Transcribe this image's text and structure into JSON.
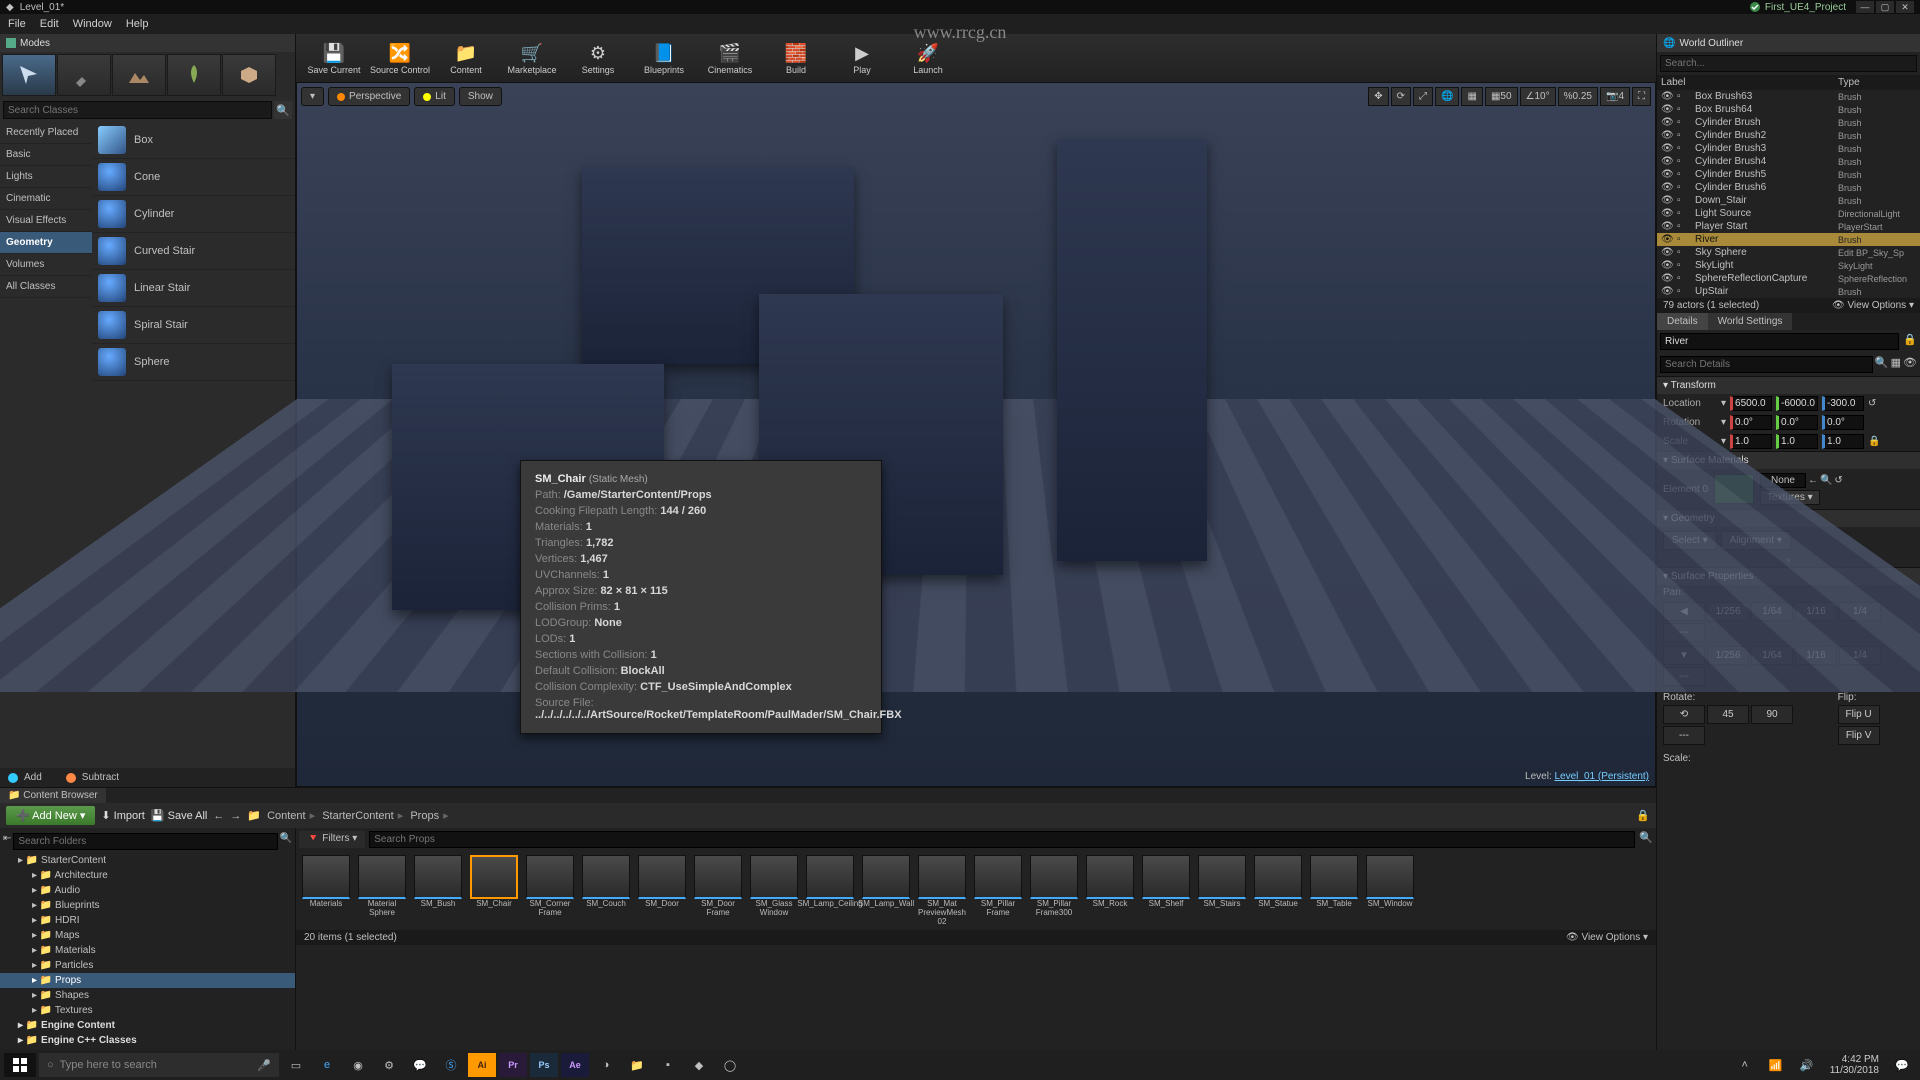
{
  "window": {
    "title": "Level_01*",
    "project": "First_UE4_Project"
  },
  "menu": {
    "file": "File",
    "edit": "Edit",
    "window": "Window",
    "help": "Help"
  },
  "watermark": "www.rrcg.cn",
  "toolbar": {
    "save": "Save Current",
    "source": "Source Control",
    "content": "Content",
    "market": "Marketplace",
    "settings": "Settings",
    "blueprints": "Blueprints",
    "cinematics": "Cinematics",
    "build": "Build",
    "play": "Play",
    "launch": "Launch"
  },
  "modes": {
    "title": "Modes",
    "search_placeholder": "Search Classes",
    "categories": [
      "Recently Placed",
      "Basic",
      "Lights",
      "Cinematic",
      "Visual Effects",
      "Geometry",
      "Volumes",
      "All Classes"
    ],
    "selected_category": "Geometry",
    "shapes": [
      "Box",
      "Cone",
      "Cylinder",
      "Curved Stair",
      "Linear Stair",
      "Spiral Stair",
      "Sphere"
    ],
    "add": "Add",
    "subtract": "Subtract"
  },
  "viewport": {
    "perspective": "Perspective",
    "lit": "Lit",
    "show": "Show",
    "grid": "50",
    "angle": "10°",
    "scale": "0.25",
    "cam": "4",
    "level_label": "Level:",
    "level_name": "Level_01 (Persistent)"
  },
  "tooltip": {
    "name": "SM_Chair",
    "type": "(Static Mesh)",
    "path_l": "Path:",
    "path_v": "/Game/StarterContent/Props",
    "cook_l": "Cooking Filepath Length:",
    "cook_v": "144 / 260",
    "mats_l": "Materials:",
    "mats_v": "1",
    "tris_l": "Triangles:",
    "tris_v": "1,782",
    "verts_l": "Vertices:",
    "verts_v": "1,467",
    "uv_l": "UVChannels:",
    "uv_v": "1",
    "size_l": "Approx Size:",
    "size_v": "82 × 81 × 115",
    "prims_l": "Collision Prims:",
    "prims_v": "1",
    "lodg_l": "LODGroup:",
    "lodg_v": "None",
    "lods_l": "LODs:",
    "lods_v": "1",
    "sect_l": "Sections with Collision:",
    "sect_v": "1",
    "defc_l": "Default Collision:",
    "defc_v": "BlockAll",
    "cc_l": "Collision Complexity:",
    "cc_v": "CTF_UseSimpleAndComplex",
    "src_l": "Source File:",
    "src_v": "../../../../../../ArtSource/Rocket/TemplateRoom/PaulMader/SM_Chair.FBX"
  },
  "outliner": {
    "title": "World Outliner",
    "search_placeholder": "Search...",
    "col_label": "Label",
    "col_type": "Type",
    "rows": [
      {
        "label": "Box Brush63",
        "type": "Brush"
      },
      {
        "label": "Box Brush64",
        "type": "Brush"
      },
      {
        "label": "Cylinder Brush",
        "type": "Brush"
      },
      {
        "label": "Cylinder Brush2",
        "type": "Brush"
      },
      {
        "label": "Cylinder Brush3",
        "type": "Brush"
      },
      {
        "label": "Cylinder Brush4",
        "type": "Brush"
      },
      {
        "label": "Cylinder Brush5",
        "type": "Brush"
      },
      {
        "label": "Cylinder Brush6",
        "type": "Brush"
      },
      {
        "label": "Down_Stair",
        "type": "Brush"
      },
      {
        "label": "Light Source",
        "type": "DirectionalLight"
      },
      {
        "label": "Player Start",
        "type": "PlayerStart"
      },
      {
        "label": "River",
        "type": "Brush",
        "sel": true
      },
      {
        "label": "Sky Sphere",
        "type": "Edit BP_Sky_Sp"
      },
      {
        "label": "SkyLight",
        "type": "SkyLight"
      },
      {
        "label": "SphereReflectionCapture",
        "type": "SphereReflection"
      },
      {
        "label": "UpStair",
        "type": "Brush"
      }
    ],
    "count": "79 actors (1 selected)",
    "view_options": "View Options"
  },
  "details": {
    "tab_details": "Details",
    "tab_world": "World Settings",
    "name": "River",
    "search_placeholder": "Search Details",
    "sec_transform": "Transform",
    "loc_l": "Location",
    "loc": [
      "6500.0",
      "-6000.0",
      "-300.0"
    ],
    "rot_l": "Rotation",
    "rot": [
      "0.0°",
      "0.0°",
      "0.0°"
    ],
    "scl_l": "Scale",
    "scl": [
      "1.0",
      "1.0",
      "1.0"
    ],
    "sec_surface_mat": "Surface Materials",
    "elem0": "Element 0",
    "mat_none": "None",
    "textures": "Textures ▾",
    "sec_geometry": "Geometry",
    "select": "Select ▾",
    "align": "Alignment ▾",
    "sec_surface_prop": "Surface Properties",
    "pan": "Pan:",
    "rotate": "Rotate:",
    "flip": "Flip:",
    "scale_l": "Scale:",
    "pan_vals": [
      "1/256",
      "1/64",
      "1/16",
      "1/4",
      "---"
    ],
    "rot_vals": [
      "45",
      "90",
      "---"
    ],
    "flip_vals": [
      "Flip U",
      "Flip V"
    ]
  },
  "content": {
    "tab": "Content Browser",
    "addnew": "Add New",
    "import": "Import",
    "saveall": "Save All",
    "crumb": [
      "Content",
      "StarterContent",
      "Props"
    ],
    "tree_search": "Search Folders",
    "tree": [
      {
        "l": "StarterContent",
        "lvl": 1
      },
      {
        "l": "Architecture",
        "lvl": 2
      },
      {
        "l": "Audio",
        "lvl": 2
      },
      {
        "l": "Blueprints",
        "lvl": 2
      },
      {
        "l": "HDRI",
        "lvl": 2
      },
      {
        "l": "Maps",
        "lvl": 2
      },
      {
        "l": "Materials",
        "lvl": 2
      },
      {
        "l": "Particles",
        "lvl": 2
      },
      {
        "l": "Props",
        "lvl": 2,
        "sel": true
      },
      {
        "l": "Shapes",
        "lvl": 2
      },
      {
        "l": "Textures",
        "lvl": 2
      },
      {
        "l": "Engine Content",
        "lvl": 0,
        "bold": true
      },
      {
        "l": "Engine C++ Classes",
        "lvl": 0,
        "bold": true
      }
    ],
    "filters": "Filters ▾",
    "asset_search": "Search Props",
    "assets": [
      "Materials",
      "Material Sphere",
      "SM_Bush",
      "SM_Chair",
      "SM_Corner Frame",
      "SM_Couch",
      "SM_Door",
      "SM_Door Frame",
      "SM_Glass Window",
      "SM_Lamp_Ceiling",
      "SM_Lamp_Wall",
      "SM_Mat PreviewMesh 02",
      "SM_Pillar Frame",
      "SM_Pillar Frame300",
      "SM_Rock",
      "SM_Shelf",
      "SM_Stairs",
      "SM_Statue",
      "SM_Table",
      "SM_Window"
    ],
    "selected_asset": "SM_Chair",
    "count": "20 items (1 selected)",
    "view_options": "View Options ▾"
  },
  "taskbar": {
    "search": "Type here to search",
    "time": "4:42 PM",
    "date": "11/30/2018"
  }
}
